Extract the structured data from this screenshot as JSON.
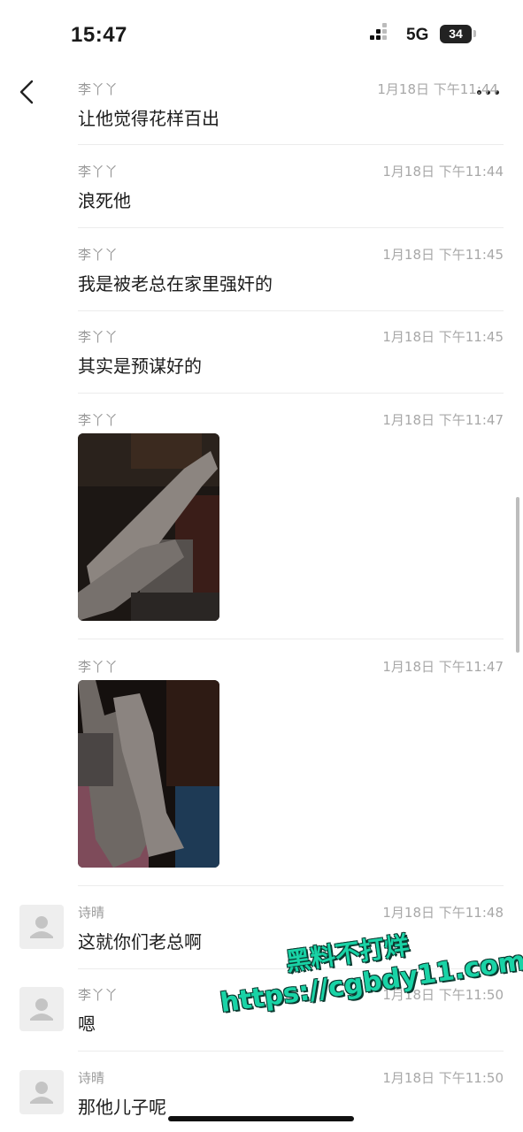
{
  "status_bar": {
    "time": "15:47",
    "network": "5G",
    "battery": "34"
  },
  "nav": {
    "back_icon": "chevron-left-icon",
    "more_icon": "more-dots-icon"
  },
  "messages": [
    {
      "sender": "李丫丫",
      "time": "1月18日 下午11:44",
      "text": "让他觉得花样百出",
      "has_avatar": false
    },
    {
      "sender": "李丫丫",
      "time": "1月18日 下午11:44",
      "text": "浪死他",
      "has_avatar": false
    },
    {
      "sender": "李丫丫",
      "time": "1月18日 下午11:45",
      "text": "我是被老总在家里强奸的",
      "has_avatar": false
    },
    {
      "sender": "李丫丫",
      "time": "1月18日 下午11:45",
      "text": "其实是预谋好的",
      "has_avatar": false
    },
    {
      "sender": "李丫丫",
      "time": "1月18日 下午11:47",
      "image": "photo-legs-1",
      "has_avatar": false
    },
    {
      "sender": "李丫丫",
      "time": "1月18日 下午11:47",
      "image": "photo-legs-2",
      "has_avatar": false
    },
    {
      "sender": "诗晴",
      "time": "1月18日 下午11:48",
      "text": "这就你们老总啊",
      "has_avatar": true
    },
    {
      "sender": "李丫丫",
      "time": "1月18日 下午11:50",
      "text": "嗯",
      "has_avatar": true
    },
    {
      "sender": "诗晴",
      "time": "1月18日 下午11:50",
      "text": "那他儿子呢",
      "has_avatar": true
    }
  ],
  "watermark": {
    "line1": "黑料不打烊",
    "line2": "https://cgbdy11.com"
  },
  "colors": {
    "watermark": "#19d3a6",
    "meta_text": "#a8a8a8",
    "separator": "#ececec"
  }
}
